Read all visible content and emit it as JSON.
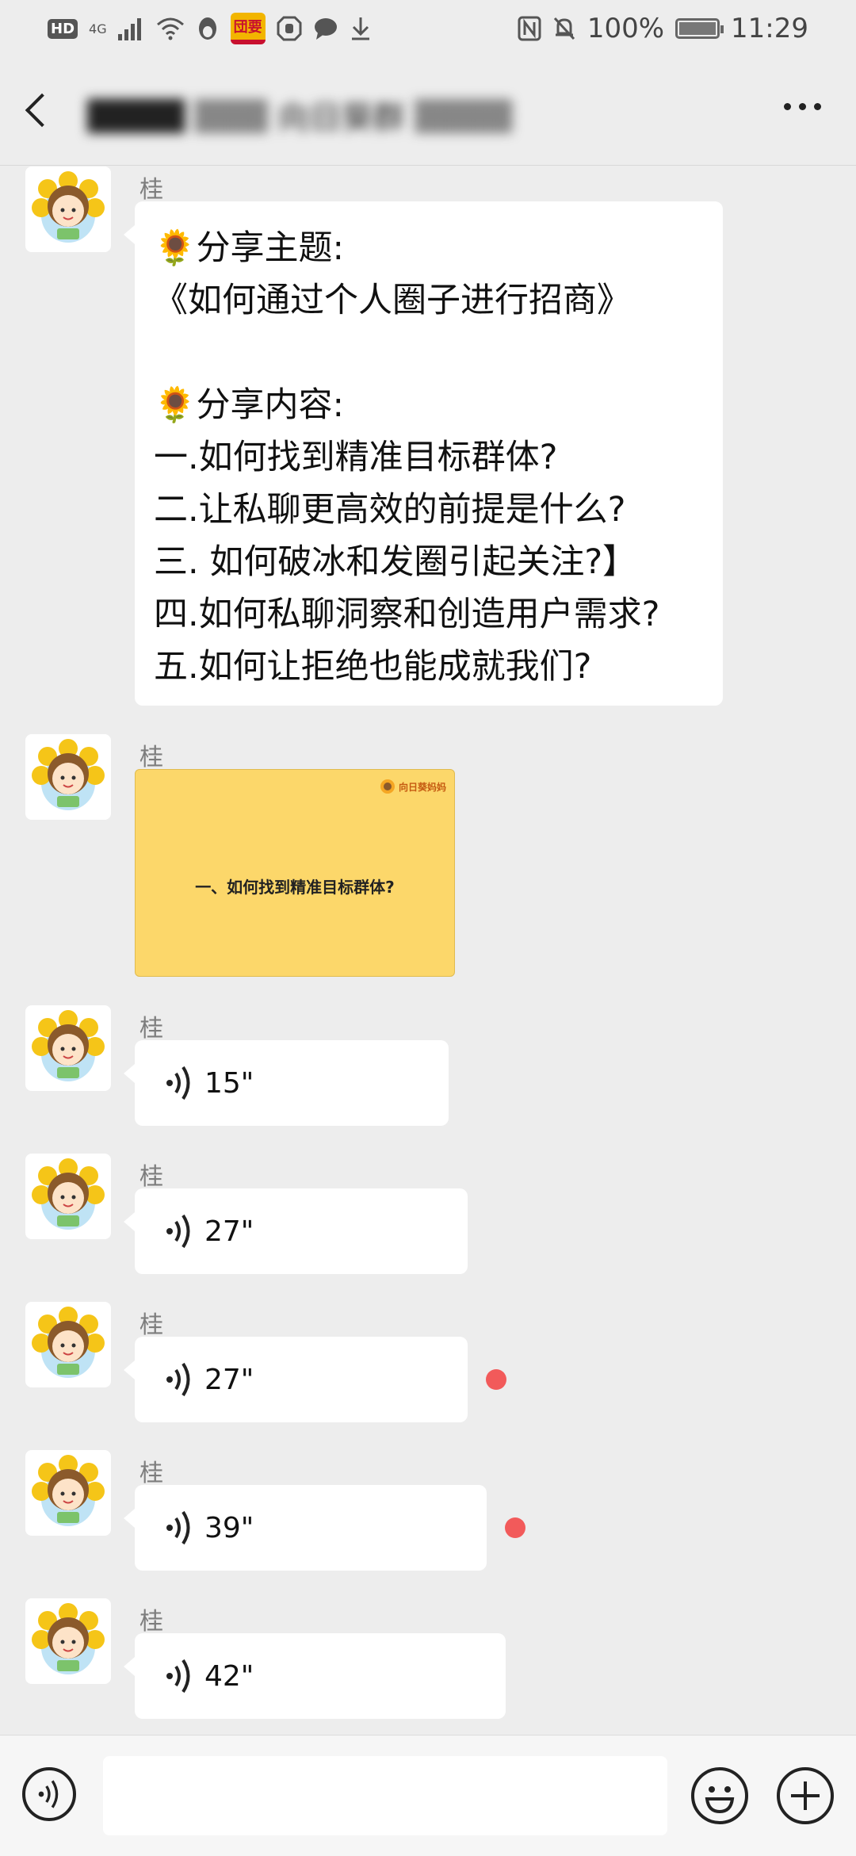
{
  "status_bar": {
    "hd": "HD",
    "network": "4G",
    "app_badge": "団要",
    "battery_percent": "100%",
    "time": "11:29"
  },
  "nav": {
    "title": "████ ▒▒▒ 向日葵群 ▒▒▒▒"
  },
  "sender_name": "桂",
  "messages": [
    {
      "kind": "text",
      "text": "🌻分享主题:\n《如何通过个人圈子进行招商》\n\n🌻分享内容:\n一.如何找到精准目标群体?\n二.让私聊更高效的前提是什么?\n三. 如何破冰和发圈引起关注?】\n四.如何私聊洞察和创造用户需求?\n五.如何让拒绝也能成就我们?"
    },
    {
      "kind": "image",
      "card_title": "一、如何找到精准目标群体?",
      "card_logo": "向日葵妈妈"
    },
    {
      "kind": "voice",
      "duration": "15\"",
      "unread": false
    },
    {
      "kind": "voice",
      "duration": "27\"",
      "unread": false
    },
    {
      "kind": "voice",
      "duration": "27\"",
      "unread": true
    },
    {
      "kind": "voice",
      "duration": "39\"",
      "unread": true
    },
    {
      "kind": "voice",
      "duration": "42\"",
      "unread": false
    }
  ],
  "colors": {
    "background": "#ededed",
    "bubble": "#ffffff",
    "unread_dot": "#f25a5a",
    "image_card": "#fcd76a"
  }
}
